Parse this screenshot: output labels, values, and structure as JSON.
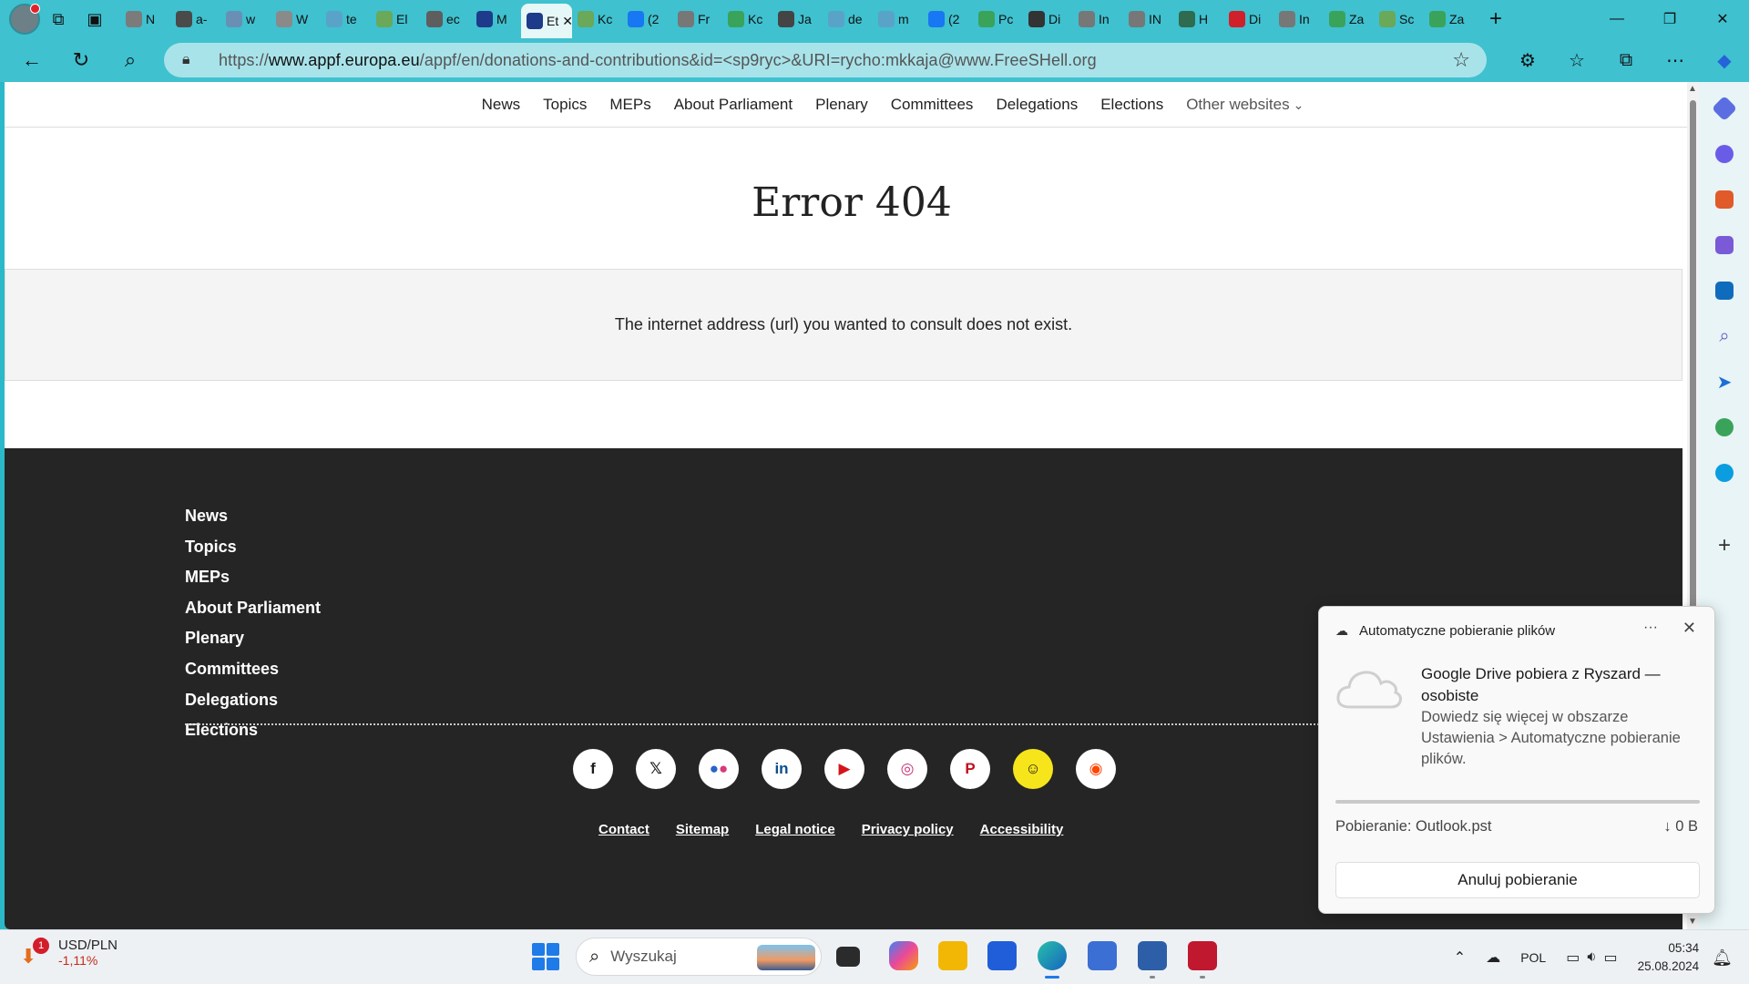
{
  "browser": {
    "tabs": [
      {
        "label": "N",
        "color": "#7b7b7b"
      },
      {
        "label": "a-",
        "color": "#4a4a4a"
      },
      {
        "label": "w",
        "color": "#6a8fb5"
      },
      {
        "label": "W",
        "color": "#8a8a8a"
      },
      {
        "label": "te",
        "color": "#5aa3c8"
      },
      {
        "label": "El",
        "color": "#6aa85a"
      },
      {
        "label": "ec",
        "color": "#5e5e5e"
      },
      {
        "label": "M",
        "color": "#1d3b8a"
      },
      {
        "label": "Et",
        "color": "#1d3b8a",
        "active": true
      },
      {
        "label": "Kc",
        "color": "#6aa85a"
      },
      {
        "label": "(2",
        "color": "#1877f2"
      },
      {
        "label": "Fr",
        "color": "#777777"
      },
      {
        "label": "Kc",
        "color": "#3aa35a"
      },
      {
        "label": "Ja",
        "color": "#444444"
      },
      {
        "label": "de",
        "color": "#5aa3c8"
      },
      {
        "label": "m",
        "color": "#5aa3c8"
      },
      {
        "label": "(2",
        "color": "#1877f2"
      },
      {
        "label": "Pc",
        "color": "#3aa35a"
      },
      {
        "label": "Di",
        "color": "#333333"
      },
      {
        "label": "In",
        "color": "#777777"
      },
      {
        "label": "IN",
        "color": "#777777"
      },
      {
        "label": "H",
        "color": "#2f6b4f"
      },
      {
        "label": "Di",
        "color": "#d0202a"
      },
      {
        "label": "In",
        "color": "#777777"
      },
      {
        "label": "Za",
        "color": "#3aa35a"
      },
      {
        "label": "Sc",
        "color": "#6aa85a"
      },
      {
        "label": "Za",
        "color": "#3aa35a"
      }
    ],
    "url_plain_prefix": "https://",
    "url_domain": "www.appf.europa.eu",
    "url_path": "/appf/en/donations-and-contributions&id=<sp9ryc>&URI=rycho:mkkaja@www.FreeSHell.org"
  },
  "page": {
    "topnav": [
      "News",
      "Topics",
      "MEPs",
      "About Parliament",
      "Plenary",
      "Committees",
      "Delegations",
      "Elections"
    ],
    "other_websites": "Other websites",
    "title": "Error 404",
    "message": "The internet address (url) you wanted to consult does not exist.",
    "footer_links": [
      "News",
      "Topics",
      "MEPs",
      "About Parliament",
      "Plenary",
      "Committees",
      "Delegations",
      "Elections"
    ],
    "social": [
      {
        "name": "facebook-icon",
        "glyph": "f"
      },
      {
        "name": "x-icon",
        "glyph": "X"
      },
      {
        "name": "flickr-icon",
        "glyph": "●●"
      },
      {
        "name": "linkedin-icon",
        "glyph": "in"
      },
      {
        "name": "youtube-icon",
        "glyph": "▶"
      },
      {
        "name": "instagram-icon",
        "glyph": "◎"
      },
      {
        "name": "pinterest-icon",
        "glyph": "P"
      },
      {
        "name": "snapchat-icon",
        "glyph": "☺"
      },
      {
        "name": "reddit-icon",
        "glyph": "◉"
      }
    ],
    "bottom_links": [
      "Contact",
      "Sitemap",
      "Legal notice",
      "Privacy policy",
      "Accessibility"
    ]
  },
  "notification": {
    "header": "Automatyczne pobieranie plików",
    "title": "Google Drive pobiera z Ryszard — osobiste",
    "desc": "Dowiedz się więcej w obszarze Ustawienia > Automatyczne pobieranie plików.",
    "file": "Pobieranie: Outlook.pst",
    "size": "0 B",
    "cancel": "Anuluj pobieranie"
  },
  "taskbar": {
    "badge": "1",
    "ticker_name": "USD/PLN",
    "ticker_value": "-1,11%",
    "search_placeholder": "Wyszukaj",
    "lang": "POL",
    "time": "05:34",
    "date": "25.08.2024"
  }
}
